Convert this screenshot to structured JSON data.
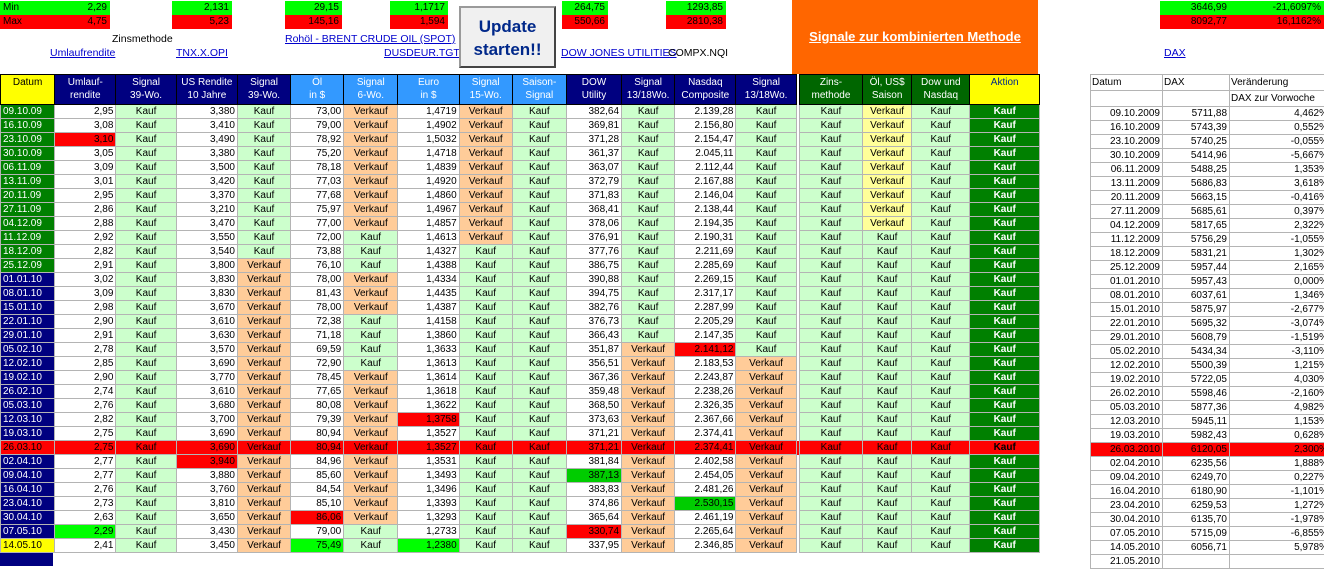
{
  "minmax": {
    "min_label": "Min",
    "max_label": "Max",
    "min": [
      "2,29",
      "2,131",
      "29,15",
      "1,1717",
      "264,75",
      "1293,85",
      "3646,99",
      "-21,6097%"
    ],
    "max": [
      "4,75",
      "5,23",
      "145,16",
      "1,594",
      "550,66",
      "2810,38",
      "8092,77",
      "16,1162%"
    ]
  },
  "labels": {
    "zins": "Zinsmethode",
    "compx": "COMPX.NQI"
  },
  "links": {
    "umlauf": "Umlaufrendite",
    "tnx": "TNX.X.OPI",
    "rohoel": "Rohöl - BRENT CRUDE OIL (SPOT)",
    "usdeur": "DUSDEUR.TGT",
    "dow": "DOW JONES UTILITIES",
    "dax": "DAX"
  },
  "update_button": "Update\nstarten!!",
  "signal_title": "Signale zur kombinierten Methode",
  "headers": [
    "Datum",
    "Umlauf-\nrendite",
    "Signal\n39-Wo.",
    "US Rendite\n10 Jahre",
    "Signal\n39-Wo.",
    "Öl\nin $",
    "Signal\n6-Wo.",
    "Euro\nin $",
    "Signal\n15-Wo.",
    "Saison-\nSignal",
    "DOW\nUtility",
    "Signal\n13/18Wo.",
    "Nasdaq\nComposite",
    "Signal\n13/18Wo.",
    "Zins-\nmethode",
    "Öl, US$\nSaison",
    "Dow und\nNasdaq",
    "Aktion"
  ],
  "dax_headers": [
    "Datum",
    "DAX",
    "Veränderung",
    "DAX zur Vorwoche"
  ],
  "rows": [
    [
      "09.10.09",
      "2,95",
      "Kauf",
      "3,380",
      "Kauf",
      "73,00",
      "Verkauf",
      "1,4719",
      "Verkauf",
      "Kauf",
      "382,64",
      "Kauf",
      "2.139,28",
      "Kauf",
      "Kauf",
      "Verkauf",
      "Kauf",
      "Kauf"
    ],
    [
      "16.10.09",
      "3,08",
      "Kauf",
      "3,410",
      "Kauf",
      "79,00",
      "Verkauf",
      "1,4902",
      "Verkauf",
      "Kauf",
      "369,81",
      "Kauf",
      "2.156,80",
      "Kauf",
      "Kauf",
      "Verkauf",
      "Kauf",
      "Kauf"
    ],
    [
      "23.10.09",
      "3,10",
      "Kauf",
      "3,490",
      "Kauf",
      "78,92",
      "Verkauf",
      "1,5032",
      "Verkauf",
      "Kauf",
      "371,28",
      "Kauf",
      "2.154,47",
      "Kauf",
      "Kauf",
      "Verkauf",
      "Kauf",
      "Kauf"
    ],
    [
      "30.10.09",
      "3,05",
      "Kauf",
      "3,380",
      "Kauf",
      "75,20",
      "Verkauf",
      "1,4718",
      "Verkauf",
      "Kauf",
      "361,37",
      "Kauf",
      "2.045,11",
      "Kauf",
      "Kauf",
      "Verkauf",
      "Kauf",
      "Kauf"
    ],
    [
      "06.11.09",
      "3,09",
      "Kauf",
      "3,500",
      "Kauf",
      "78,18",
      "Verkauf",
      "1,4839",
      "Verkauf",
      "Kauf",
      "363,07",
      "Kauf",
      "2.112,44",
      "Kauf",
      "Kauf",
      "Verkauf",
      "Kauf",
      "Kauf"
    ],
    [
      "13.11.09",
      "3,01",
      "Kauf",
      "3,420",
      "Kauf",
      "77,03",
      "Verkauf",
      "1,4920",
      "Verkauf",
      "Kauf",
      "372,79",
      "Kauf",
      "2.167,88",
      "Kauf",
      "Kauf",
      "Verkauf",
      "Kauf",
      "Kauf"
    ],
    [
      "20.11.09",
      "2,95",
      "Kauf",
      "3,370",
      "Kauf",
      "77,68",
      "Verkauf",
      "1,4860",
      "Verkauf",
      "Kauf",
      "371,83",
      "Kauf",
      "2.146,04",
      "Kauf",
      "Kauf",
      "Verkauf",
      "Kauf",
      "Kauf"
    ],
    [
      "27.11.09",
      "2,86",
      "Kauf",
      "3,210",
      "Kauf",
      "75,97",
      "Verkauf",
      "1,4967",
      "Verkauf",
      "Kauf",
      "368,41",
      "Kauf",
      "2.138,44",
      "Kauf",
      "Kauf",
      "Verkauf",
      "Kauf",
      "Kauf"
    ],
    [
      "04.12.09",
      "2,88",
      "Kauf",
      "3,470",
      "Kauf",
      "77,00",
      "Verkauf",
      "1,4857",
      "Verkauf",
      "Kauf",
      "378,06",
      "Kauf",
      "2.194,35",
      "Kauf",
      "Kauf",
      "Verkauf",
      "Kauf",
      "Kauf"
    ],
    [
      "11.12.09",
      "2,92",
      "Kauf",
      "3,550",
      "Kauf",
      "72,00",
      "Kauf",
      "1,4613",
      "Verkauf",
      "Kauf",
      "376,91",
      "Kauf",
      "2.190,31",
      "Kauf",
      "Kauf",
      "Kauf",
      "Kauf",
      "Kauf"
    ],
    [
      "18.12.09",
      "2,82",
      "Kauf",
      "3,540",
      "Kauf",
      "73,88",
      "Kauf",
      "1,4327",
      "Kauf",
      "Kauf",
      "377,76",
      "Kauf",
      "2.211,69",
      "Kauf",
      "Kauf",
      "Kauf",
      "Kauf",
      "Kauf"
    ],
    [
      "25.12.09",
      "2,91",
      "Kauf",
      "3,800",
      "Verkauf",
      "76,10",
      "Kauf",
      "1,4388",
      "Kauf",
      "Kauf",
      "386,75",
      "Kauf",
      "2.285,69",
      "Kauf",
      "Kauf",
      "Kauf",
      "Kauf",
      "Kauf"
    ],
    [
      "01.01.10",
      "3,02",
      "Kauf",
      "3,830",
      "Verkauf",
      "78,00",
      "Verkauf",
      "1,4334",
      "Kauf",
      "Kauf",
      "390,88",
      "Kauf",
      "2.269,15",
      "Kauf",
      "Kauf",
      "Kauf",
      "Kauf",
      "Kauf"
    ],
    [
      "08.01.10",
      "3,09",
      "Kauf",
      "3,830",
      "Verkauf",
      "81,43",
      "Verkauf",
      "1,4435",
      "Kauf",
      "Kauf",
      "394,75",
      "Kauf",
      "2.317,17",
      "Kauf",
      "Kauf",
      "Kauf",
      "Kauf",
      "Kauf"
    ],
    [
      "15.01.10",
      "2,98",
      "Kauf",
      "3,670",
      "Verkauf",
      "78,00",
      "Verkauf",
      "1,4387",
      "Kauf",
      "Kauf",
      "382,76",
      "Kauf",
      "2.287,99",
      "Kauf",
      "Kauf",
      "Kauf",
      "Kauf",
      "Kauf"
    ],
    [
      "22.01.10",
      "2,90",
      "Kauf",
      "3,610",
      "Verkauf",
      "72,38",
      "Kauf",
      "1,4158",
      "Kauf",
      "Kauf",
      "376,73",
      "Kauf",
      "2.205,29",
      "Kauf",
      "Kauf",
      "Kauf",
      "Kauf",
      "Kauf"
    ],
    [
      "29.01.10",
      "2,91",
      "Kauf",
      "3,630",
      "Verkauf",
      "71,18",
      "Kauf",
      "1,3860",
      "Kauf",
      "Kauf",
      "366,43",
      "Kauf",
      "2.147,35",
      "Kauf",
      "Kauf",
      "Kauf",
      "Kauf",
      "Kauf"
    ],
    [
      "05.02.10",
      "2,78",
      "Kauf",
      "3,570",
      "Verkauf",
      "69,59",
      "Kauf",
      "1,3633",
      "Kauf",
      "Kauf",
      "351,87",
      "Verkauf",
      "2.141,12",
      "Kauf",
      "Kauf",
      "Kauf",
      "Kauf",
      "Kauf"
    ],
    [
      "12.02.10",
      "2,85",
      "Kauf",
      "3,690",
      "Verkauf",
      "72,90",
      "Kauf",
      "1,3613",
      "Kauf",
      "Kauf",
      "356,51",
      "Verkauf",
      "2.183,53",
      "Verkauf",
      "Kauf",
      "Kauf",
      "Kauf",
      "Kauf"
    ],
    [
      "19.02.10",
      "2,90",
      "Kauf",
      "3,770",
      "Verkauf",
      "78,45",
      "Verkauf",
      "1,3614",
      "Kauf",
      "Kauf",
      "367,36",
      "Verkauf",
      "2.243,87",
      "Verkauf",
      "Kauf",
      "Kauf",
      "Kauf",
      "Kauf"
    ],
    [
      "26.02.10",
      "2,74",
      "Kauf",
      "3,610",
      "Verkauf",
      "77,65",
      "Verkauf",
      "1,3618",
      "Kauf",
      "Kauf",
      "359,48",
      "Verkauf",
      "2.238,26",
      "Verkauf",
      "Kauf",
      "Kauf",
      "Kauf",
      "Kauf"
    ],
    [
      "05.03.10",
      "2,76",
      "Kauf",
      "3,680",
      "Verkauf",
      "80,08",
      "Verkauf",
      "1,3622",
      "Kauf",
      "Kauf",
      "368,50",
      "Verkauf",
      "2.326,35",
      "Verkauf",
      "Kauf",
      "Kauf",
      "Kauf",
      "Kauf"
    ],
    [
      "12.03.10",
      "2,82",
      "Kauf",
      "3,700",
      "Verkauf",
      "79,39",
      "Verkauf",
      "1,3758",
      "Kauf",
      "Kauf",
      "373,63",
      "Verkauf",
      "2.367,66",
      "Verkauf",
      "Kauf",
      "Kauf",
      "Kauf",
      "Kauf"
    ],
    [
      "19.03.10",
      "2,75",
      "Kauf",
      "3,690",
      "Verkauf",
      "80,94",
      "Verkauf",
      "1,3527",
      "Kauf",
      "Kauf",
      "371,21",
      "Verkauf",
      "2.374,41",
      "Verkauf",
      "Kauf",
      "Kauf",
      "Kauf",
      "Kauf"
    ],
    [
      "26.03.10",
      "2,75",
      "Kauf",
      "3,690",
      "Verkauf",
      "80,94",
      "Verkauf",
      "1,3527",
      "Kauf",
      "Kauf",
      "371,21",
      "Verkauf",
      "2.374,41",
      "Verkauf",
      "Kauf",
      "Kauf",
      "Kauf",
      "Kauf"
    ],
    [
      "02.04.10",
      "2,77",
      "Kauf",
      "3,940",
      "Verkauf",
      "84,96",
      "Verkauf",
      "1,3531",
      "Kauf",
      "Kauf",
      "381,84",
      "Verkauf",
      "2.402,58",
      "Verkauf",
      "Kauf",
      "Kauf",
      "Kauf",
      "Kauf"
    ],
    [
      "09.04.10",
      "2,77",
      "Kauf",
      "3,880",
      "Verkauf",
      "85,60",
      "Verkauf",
      "1,3493",
      "Kauf",
      "Kauf",
      "387,13",
      "Verkauf",
      "2.454,05",
      "Verkauf",
      "Kauf",
      "Kauf",
      "Kauf",
      "Kauf"
    ],
    [
      "16.04.10",
      "2,76",
      "Kauf",
      "3,760",
      "Verkauf",
      "84,54",
      "Verkauf",
      "1,3496",
      "Kauf",
      "Kauf",
      "383,83",
      "Verkauf",
      "2.481,26",
      "Verkauf",
      "Kauf",
      "Kauf",
      "Kauf",
      "Kauf"
    ],
    [
      "23.04.10",
      "2,73",
      "Kauf",
      "3,810",
      "Verkauf",
      "85,10",
      "Verkauf",
      "1,3393",
      "Kauf",
      "Kauf",
      "374,86",
      "Verkauf",
      "2.530,15",
      "Verkauf",
      "Kauf",
      "Kauf",
      "Kauf",
      "Kauf"
    ],
    [
      "30.04.10",
      "2,63",
      "Kauf",
      "3,650",
      "Verkauf",
      "86,06",
      "Verkauf",
      "1,3293",
      "Kauf",
      "Kauf",
      "365,64",
      "Verkauf",
      "2.461,19",
      "Verkauf",
      "Kauf",
      "Kauf",
      "Kauf",
      "Kauf"
    ],
    [
      "07.05.10",
      "2,29",
      "Kauf",
      "3,430",
      "Verkauf",
      "79,00",
      "Kauf",
      "1,2733",
      "Kauf",
      "Kauf",
      "330,74",
      "Verkauf",
      "2.265,64",
      "Verkauf",
      "Kauf",
      "Kauf",
      "Kauf",
      "Kauf"
    ],
    [
      "14.05.10",
      "2,41",
      "Kauf",
      "3,450",
      "Verkauf",
      "75,49",
      "Kauf",
      "1,2380",
      "Kauf",
      "Kauf",
      "337,95",
      "Verkauf",
      "2.346,85",
      "Verkauf",
      "Kauf",
      "Kauf",
      "Kauf",
      "Kauf"
    ]
  ],
  "dax_rows": [
    [
      "09.10.2009",
      "5711,88",
      "4,462%"
    ],
    [
      "16.10.2009",
      "5743,39",
      "0,552%"
    ],
    [
      "23.10.2009",
      "5740,25",
      "-0,055%"
    ],
    [
      "30.10.2009",
      "5414,96",
      "-5,667%"
    ],
    [
      "06.11.2009",
      "5488,25",
      "1,353%"
    ],
    [
      "13.11.2009",
      "5686,83",
      "3,618%"
    ],
    [
      "20.11.2009",
      "5663,15",
      "-0,416%"
    ],
    [
      "27.11.2009",
      "5685,61",
      "0,397%"
    ],
    [
      "04.12.2009",
      "5817,65",
      "2,322%"
    ],
    [
      "11.12.2009",
      "5756,29",
      "-1,055%"
    ],
    [
      "18.12.2009",
      "5831,21",
      "1,302%"
    ],
    [
      "25.12.2009",
      "5957,44",
      "2,165%"
    ],
    [
      "01.01.2010",
      "5957,43",
      "0,000%"
    ],
    [
      "08.01.2010",
      "6037,61",
      "1,346%"
    ],
    [
      "15.01.2010",
      "5875,97",
      "-2,677%"
    ],
    [
      "22.01.2010",
      "5695,32",
      "-3,074%"
    ],
    [
      "29.01.2010",
      "5608,79",
      "-1,519%"
    ],
    [
      "05.02.2010",
      "5434,34",
      "-3,110%"
    ],
    [
      "12.02.2010",
      "5500,39",
      "1,215%"
    ],
    [
      "19.02.2010",
      "5722,05",
      "4,030%"
    ],
    [
      "26.02.2010",
      "5598,46",
      "-2,160%"
    ],
    [
      "05.03.2010",
      "5877,36",
      "4,982%"
    ],
    [
      "12.03.2010",
      "5945,11",
      "1,153%"
    ],
    [
      "19.03.2010",
      "5982,43",
      "0,628%"
    ],
    [
      "26.03.2010",
      "6120,05",
      "2,300%"
    ],
    [
      "02.04.2010",
      "6235,56",
      "1,888%"
    ],
    [
      "09.04.2010",
      "6249,70",
      "0,227%"
    ],
    [
      "16.04.2010",
      "6180,90",
      "-1,101%"
    ],
    [
      "23.04.2010",
      "6259,53",
      "1,272%"
    ],
    [
      "30.04.2010",
      "6135,70",
      "-1,978%"
    ],
    [
      "07.05.2010",
      "5715,09",
      "-6,855%"
    ],
    [
      "14.05.2010",
      "6056,71",
      "5,978%"
    ],
    [
      "21.05.2010",
      "",
      ""
    ]
  ]
}
